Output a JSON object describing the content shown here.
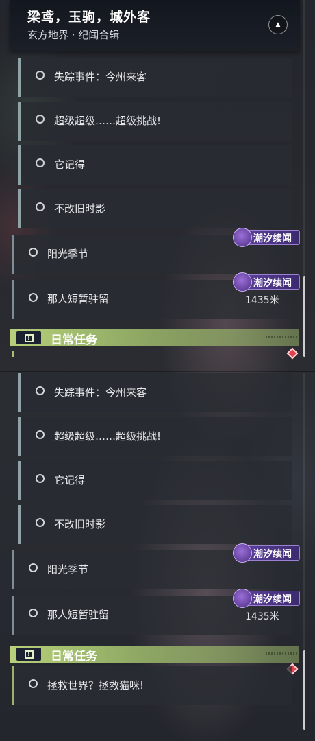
{
  "header": {
    "title": "梁鸢，玉驹，城外客",
    "subtitle": "玄方地界 · 纪闻合辑"
  },
  "quests": [
    {
      "label": "失踪事件：今州来客"
    },
    {
      "label": "超级超级……超级挑战!"
    },
    {
      "label": "它记得"
    },
    {
      "label": "不改旧时影"
    }
  ],
  "main_quests": [
    {
      "label": "阳光季节",
      "badge": "潮汐续闻"
    },
    {
      "label": "那人短暂驻留",
      "badge": "潮汐续闻",
      "distance": "1435米"
    }
  ],
  "daily_section": {
    "label": "日常任务"
  },
  "daily_quests": [
    {
      "label": "拯救世界？拯救猫咪!"
    }
  ],
  "colors": {
    "daily_accent": "#b8d07a",
    "badge_purple": "#5a3f9a",
    "track_marker": "#e0434e"
  },
  "icons": [
    "chevron-up-icon",
    "radio-circle-icon",
    "tide-feather-icon",
    "exclamation-icon",
    "track-diamond-icon"
  ]
}
